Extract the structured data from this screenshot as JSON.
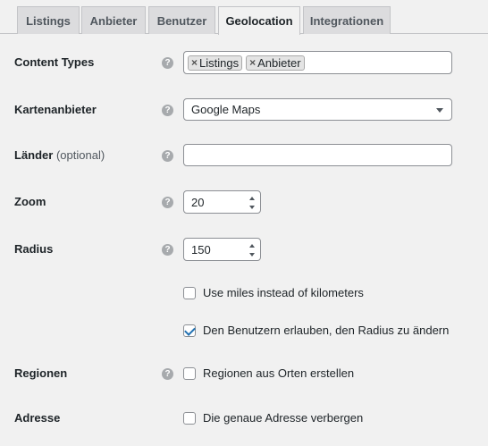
{
  "tabs": [
    {
      "label": "Listings",
      "active": false
    },
    {
      "label": "Anbieter",
      "active": false
    },
    {
      "label": "Benutzer",
      "active": false
    },
    {
      "label": "Geolocation",
      "active": true
    },
    {
      "label": "Integrationen",
      "active": false
    }
  ],
  "help_glyph": "?",
  "content_types": {
    "label": "Content Types",
    "tags": [
      "Listings",
      "Anbieter"
    ],
    "remove_glyph": "×"
  },
  "map_provider": {
    "label": "Kartenanbieter",
    "value": "Google Maps"
  },
  "countries": {
    "label": "Länder",
    "optional": "(optional)",
    "value": ""
  },
  "zoom": {
    "label": "Zoom",
    "value": "20"
  },
  "radius": {
    "label": "Radius",
    "value": "150",
    "use_miles": {
      "label": "Use miles instead of kilometers",
      "checked": false
    },
    "allow_change": {
      "label": "Den Benutzern erlauben, den Radius zu ändern",
      "checked": true
    }
  },
  "regions": {
    "label": "Regionen",
    "option": {
      "label": "Regionen aus Orten erstellen",
      "checked": false
    }
  },
  "address": {
    "label": "Adresse",
    "option": {
      "label": "Die genaue Adresse verbergen",
      "checked": false
    }
  }
}
